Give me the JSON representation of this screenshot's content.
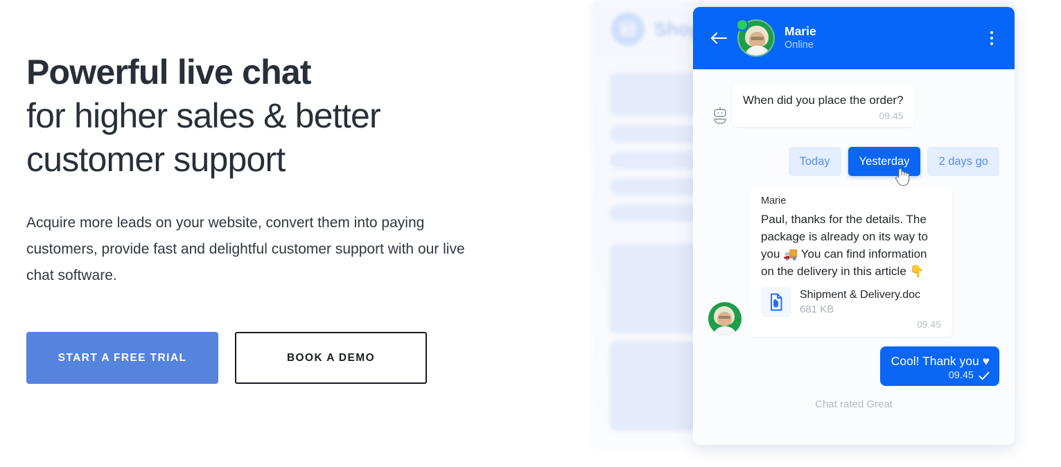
{
  "hero": {
    "headline_bold": "Powerful live chat",
    "headline_line2": "for higher sales & better",
    "headline_line3": "customer support",
    "subcopy": "Acquire more leads on your website, convert them into paying customers, provide fast and delightful customer support with our live chat software.",
    "cta_primary": "START A FREE TRIAL",
    "cta_secondary": "BOOK A DEMO",
    "colors": {
      "headline": "#282f39",
      "primary_button": "#5583de",
      "secondary_border": "#181c22"
    }
  },
  "background_panel": {
    "shop_label": "Shop",
    "shop_icon": "store-icon",
    "skeleton_blocks": 7
  },
  "chat": {
    "header": {
      "back_icon": "back-arrow-icon",
      "agent_name": "Marie",
      "status": "Online",
      "menu_icon": "kebab-menu-icon",
      "color": "#0566f9"
    },
    "messages": [
      {
        "sender": "bot",
        "icon": "robot-icon",
        "text": "When did you place the order?",
        "time": "09.45"
      },
      {
        "sender": "agent",
        "name": "Marie",
        "text": "Paul, thanks for the details. The package is already on its way to you 🚚 You can find information on the delivery in this article 👇",
        "attachment": {
          "icon": "document-attachment-icon",
          "filename": "Shipment & Delivery.doc",
          "filesize": "681 KB"
        },
        "time": "09.45"
      },
      {
        "sender": "visitor",
        "text": "Cool! Thank you ♥",
        "time": "09.45",
        "status_icon": "sent-check-icon"
      }
    ],
    "quick_replies": [
      {
        "label": "Today",
        "selected": false
      },
      {
        "label": "Yesterday",
        "selected": true
      },
      {
        "label": "2 days go",
        "selected": false
      }
    ],
    "cursor_icon": "pointer-hand-cursor",
    "footer_note": "Chat rated Great",
    "colors": {
      "chip_selected": "#0a66f5",
      "chip_idle_bg": "#e3eefe",
      "chip_idle_text": "#5b8ef0",
      "outgoing_bubble": "#0a66f5"
    }
  }
}
